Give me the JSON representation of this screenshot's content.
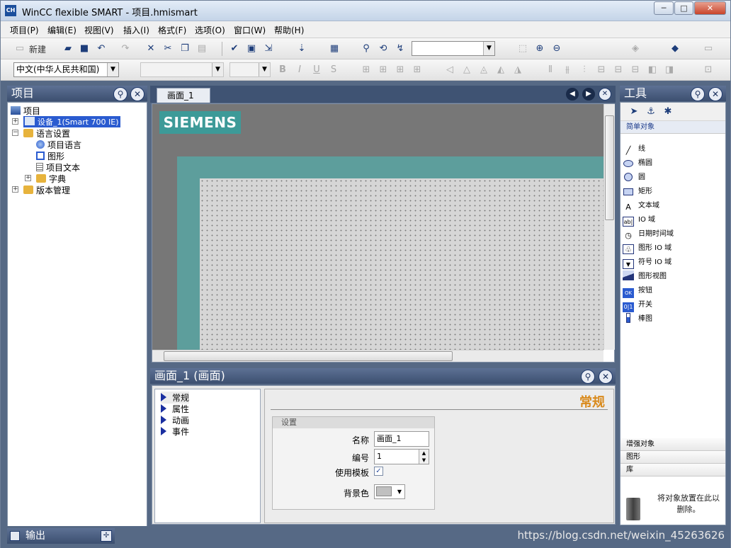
{
  "window": {
    "title": "WinCC flexible SMART - 项目.hmismart",
    "app_icon": "wincc-app-icon",
    "controls": {
      "minimize": "─",
      "maximize": "□",
      "close": "✕"
    }
  },
  "menu": [
    "项目(P)",
    "编辑(E)",
    "视图(V)",
    "插入(I)",
    "格式(F)",
    "选项(O)",
    "窗口(W)",
    "帮助(H)"
  ],
  "toolbar": {
    "new_label": "新建",
    "language_combo": "中文(中华人民共和国)",
    "font_buttons": [
      "B",
      "I",
      "U",
      "S"
    ]
  },
  "project_panel": {
    "title": "项目",
    "tree": [
      {
        "label": "项目",
        "level": 0,
        "icon": "project-icon"
      },
      {
        "label": "设备_1(Smart 700 IE)",
        "level": 1,
        "icon": "device-icon",
        "selected": true
      },
      {
        "label": "语言设置",
        "level": 1,
        "icon": "folder-icon",
        "expanded": true
      },
      {
        "label": "项目语言",
        "level": 2,
        "icon": "globe-icon"
      },
      {
        "label": "图形",
        "level": 2,
        "icon": "graphics-icon"
      },
      {
        "label": "项目文本",
        "level": 2,
        "icon": "text-icon"
      },
      {
        "label": "字典",
        "level": 2,
        "icon": "folder-icon"
      },
      {
        "label": "版本管理",
        "level": 1,
        "icon": "folder-icon"
      }
    ]
  },
  "editor": {
    "tab_label": "画面_1",
    "logo_text": "SIEMENS"
  },
  "properties": {
    "header": "画面_1 (画面)",
    "nav": [
      "常规",
      "属性",
      "动画",
      "事件"
    ],
    "section_title": "常规",
    "group_title": "设置",
    "name_label": "名称",
    "name_value": "画面_1",
    "number_label": "编号",
    "number_value": "1",
    "template_label": "使用模板",
    "template_checked": "✓",
    "bgcolor_label": "背景色",
    "bgcolor_value": "#c0c0c0"
  },
  "tools": {
    "title": "工具",
    "active_section": "简单对象",
    "items": [
      {
        "label": "线",
        "icon": "line-icon"
      },
      {
        "label": "椭圆",
        "icon": "ellipse-icon"
      },
      {
        "label": "圆",
        "icon": "circle-icon"
      },
      {
        "label": "矩形",
        "icon": "rectangle-icon"
      },
      {
        "label": "文本域",
        "icon": "text-field-icon"
      },
      {
        "label": "IO 域",
        "icon": "io-field-icon"
      },
      {
        "label": "日期时间域",
        "icon": "datetime-icon"
      },
      {
        "label": "图形 IO 域",
        "icon": "graphic-io-icon"
      },
      {
        "label": "符号 IO 域",
        "icon": "symbolic-io-icon"
      },
      {
        "label": "图形视图",
        "icon": "graphic-view-icon"
      },
      {
        "label": "按钮",
        "icon": "button-icon"
      },
      {
        "label": "开关",
        "icon": "switch-icon"
      },
      {
        "label": "棒图",
        "icon": "bar-icon"
      }
    ],
    "sections_below": [
      "增强对象",
      "图形",
      "库"
    ],
    "library_hint": "将对象放置在此以删除。"
  },
  "output": {
    "label": "输出"
  },
  "watermark": "https://blog.csdn.net/weixin_45263626",
  "colors": {
    "accent_blue": "#1a2fa0",
    "panel_header": "#3c4f70",
    "siemens_teal": "#3d9a98",
    "general_title_orange": "#d98a1c"
  }
}
